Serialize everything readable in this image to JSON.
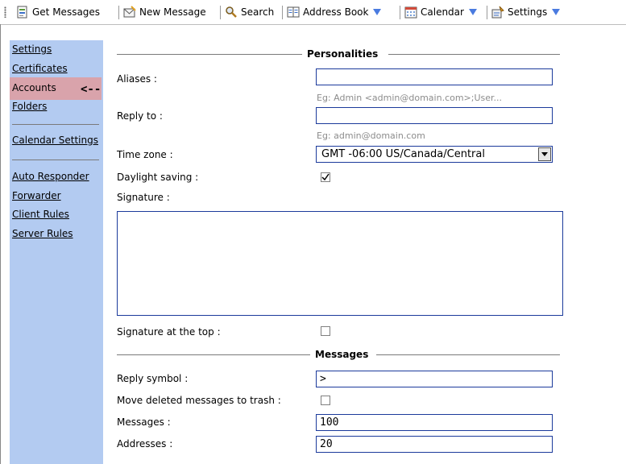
{
  "toolbar": {
    "get_messages": "Get Messages",
    "new_message": "New Message",
    "search": "Search",
    "address_book": "Address Book",
    "calendar": "Calendar",
    "settings": "Settings"
  },
  "sidebar": {
    "items": [
      {
        "label": "Settings"
      },
      {
        "label": "Certificates"
      },
      {
        "label": "Accounts",
        "selected": true
      },
      {
        "label": "Folders"
      },
      {
        "label": "Calendar Settings"
      },
      {
        "label": "Auto Responder"
      },
      {
        "label": "Forwarder"
      },
      {
        "label": "Client Rules"
      },
      {
        "label": "Server Rules"
      }
    ],
    "pointer": "<--"
  },
  "form": {
    "personalities_title": "Personalities",
    "aliases_label": "Aliases :",
    "aliases_value": "",
    "aliases_hint": "Eg: Admin <admin@domain.com>;User...",
    "reply_to_label": "Reply to :",
    "reply_to_value": "",
    "reply_to_hint": "Eg: admin@domain.com",
    "timezone_label": "Time zone :",
    "timezone_value": "GMT -06:00 US/Canada/Central",
    "daylight_label": "Daylight saving :",
    "daylight_checked": true,
    "signature_label": "Signature :",
    "signature_value": "",
    "sig_top_label": "Signature at the top :",
    "sig_top_checked": false,
    "messages_title": "Messages",
    "reply_symbol_label": "Reply symbol :",
    "reply_symbol_value": ">",
    "move_trash_label": "Move deleted messages to trash :",
    "move_trash_checked": false,
    "messages_label": "Messages :",
    "messages_value": "100",
    "addresses_label": "Addresses :",
    "addresses_value": "20"
  },
  "colors": {
    "sidebar_bg": "#b3cbf1",
    "selected_bg": "#d9a3ab",
    "field_border": "#1b3a9b",
    "dropdown_arrow": "#4a7be0"
  }
}
